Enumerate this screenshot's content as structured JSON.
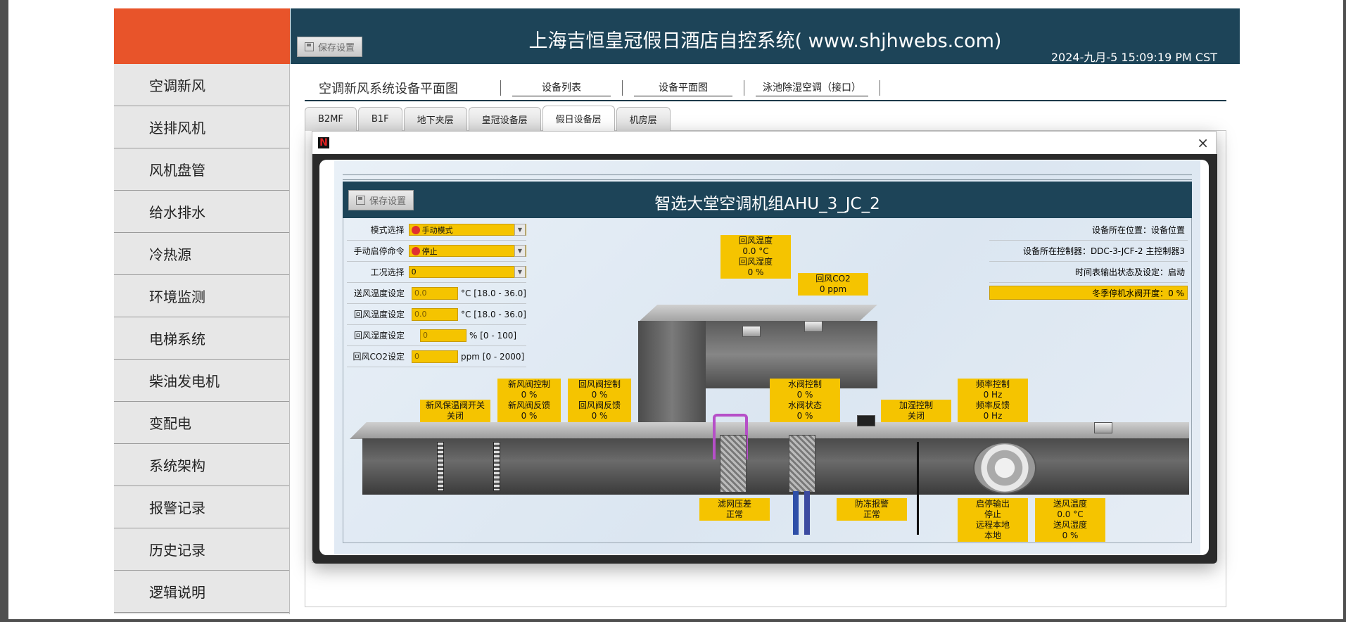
{
  "header": {
    "title": "上海吉恒皇冠假日酒店自控系统( www.shjhwebs.com)",
    "datetime": "2024-九月-5 15:09:19 PM CST",
    "save_label": "保存设置"
  },
  "sidebar": {
    "items": [
      {
        "label": "空调新风"
      },
      {
        "label": "送排风机"
      },
      {
        "label": "风机盘管"
      },
      {
        "label": "给水排水"
      },
      {
        "label": "冷热源"
      },
      {
        "label": "环境监测"
      },
      {
        "label": "电梯系统"
      },
      {
        "label": "柴油发电机"
      },
      {
        "label": "变配电"
      },
      {
        "label": "系统架构"
      },
      {
        "label": "报警记录"
      },
      {
        "label": "历史记录"
      },
      {
        "label": "逻辑说明"
      }
    ]
  },
  "nav": {
    "title": "空调新风系统设备平面图",
    "links": [
      "设备列表",
      "设备平面图",
      "泳池除湿空调（接口）"
    ]
  },
  "tabs": [
    "B2MF",
    "B1F",
    "地下夹层",
    "皇冠设备层",
    "假日设备层",
    "机房层"
  ],
  "active_tab": "假日设备层",
  "modal": {
    "close": "×",
    "logo": "N",
    "save_label": "保存设置",
    "title": "智选大堂空调机组AHU_3_JC_2",
    "form": {
      "mode": {
        "label": "模式选择",
        "value": "手动模式"
      },
      "manual_cmd": {
        "label": "手动启停命令",
        "value": "停止"
      },
      "condition": {
        "label": "工况选择",
        "value": "0"
      },
      "supply_temp": {
        "label": "送风温度设定",
        "value": "0.0",
        "unit": "°C [18.0 - 36.0]"
      },
      "return_temp": {
        "label": "回风温度设定",
        "value": "0.0",
        "unit": "°C [18.0 - 36.0]"
      },
      "return_hum": {
        "label": "回风湿度设定",
        "value": "0",
        "unit": "% [0 - 100]"
      },
      "return_co2": {
        "label": "回风CO2设定",
        "value": "0",
        "unit": "ppm [0 - 2000]"
      }
    },
    "info": {
      "location": "设备所在位置：设备位置",
      "controller": "设备所在控制器：DDC-3-JCF-2 主控制器3",
      "schedule": "时间表输出状态及设定：启动",
      "winter_valve": "冬季停机水阀开度：0 %"
    },
    "labels": {
      "return_temp": "回风温度",
      "return_temp_val": "0.0 °C",
      "return_hum": "回风湿度",
      "return_hum_val": "0 %",
      "return_co2": "回风CO2",
      "return_co2_val": "0 ppm",
      "fresh_insul": "新风保温阀开关",
      "fresh_insul_val": "关闭",
      "fresh_ctrl": "新风阀控制",
      "fresh_ctrl_val": "0 %",
      "fresh_fb": "新风阀反馈",
      "fresh_fb_val": "0 %",
      "ret_ctrl": "回风阀控制",
      "ret_ctrl_val": "0 %",
      "ret_fb": "回风阀反馈",
      "ret_fb_val": "0 %",
      "water_ctrl": "水阀控制",
      "water_ctrl_val": "0 %",
      "water_state": "水阀状态",
      "water_state_val": "0 %",
      "humid_ctrl": "加湿控制",
      "humid_ctrl_val": "关闭",
      "freq_ctrl": "频率控制",
      "freq_ctrl_val": "0 Hz",
      "freq_fb": "频率反馈",
      "freq_fb_val": "0 Hz",
      "filter_dp": "滤网压差",
      "filter_dp_val": "正常",
      "freeze": "防冻报警",
      "freeze_val": "正常",
      "start_out": "启停输出",
      "start_out_val": "停止",
      "remote_local": "远程本地",
      "remote_local_val": "本地",
      "supply_temp": "送风温度",
      "supply_temp_val": "0.0 °C",
      "supply_hum": "送风湿度",
      "supply_hum_val": "0 %"
    }
  },
  "colors": {
    "header_bg": "#1d4458",
    "logo_bg": "#e8542a",
    "highlight": "#f5c400"
  }
}
